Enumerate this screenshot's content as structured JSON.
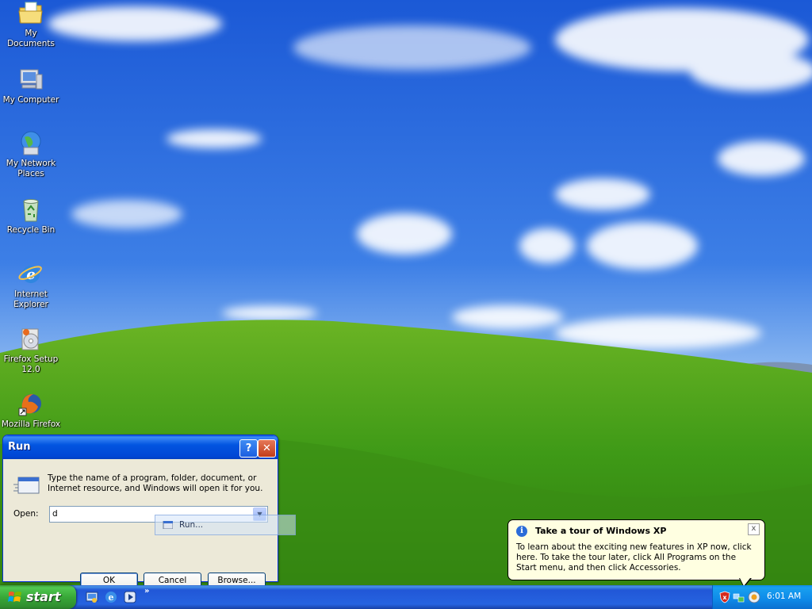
{
  "desktop": {
    "icons": [
      {
        "name": "my-documents",
        "label": "My Documents"
      },
      {
        "name": "my-computer",
        "label": "My Computer"
      },
      {
        "name": "my-network-places",
        "label": "My Network Places"
      },
      {
        "name": "recycle-bin",
        "label": "Recycle Bin"
      },
      {
        "name": "internet-explorer",
        "label": "Internet Explorer"
      },
      {
        "name": "firefox-setup",
        "label": "Firefox Setup 12.0"
      },
      {
        "name": "mozilla-firefox",
        "label": "Mozilla Firefox"
      }
    ]
  },
  "run_dialog": {
    "title": "Run",
    "help_glyph": "?",
    "close_glyph": "✕",
    "description": "Type the name of a program, folder, document, or Internet resource, and Windows will open it for you.",
    "open_label": "Open:",
    "open_value": "d",
    "autocomplete_item": "Run...",
    "ok_label": "OK",
    "cancel_label": "Cancel",
    "browse_label": "Browse..."
  },
  "balloon": {
    "title": "Take a tour of Windows XP",
    "text": "To learn about the exciting new features in XP now, click here. To take the tour later, click All Programs on the Start menu, and then click Accessories.",
    "close_glyph": "x",
    "info_glyph": "i"
  },
  "taskbar": {
    "start_label": "start",
    "quick_launch": [
      "show-desktop-icon",
      "internet-explorer-icon",
      "media-player-icon"
    ],
    "chevron": "»",
    "tray_icons": [
      "security-alert-icon",
      "network-icon",
      "windows-tour-icon"
    ],
    "clock": "6:01 AM"
  },
  "colors": {
    "title_bar": "#0255e0",
    "start_green": "#38a838",
    "taskbar_blue": "#2663e0",
    "tray_blue": "#0e8ae8",
    "balloon_bg": "#ffffe1"
  }
}
